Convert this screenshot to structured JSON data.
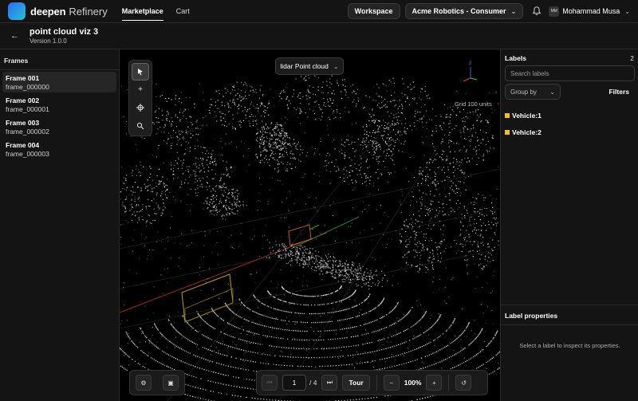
{
  "topbar": {
    "brand": "deepen",
    "brand_sub": "Refinery",
    "nav": [
      "Marketplace",
      "Cart"
    ],
    "workspace_label": "Workspace",
    "org_select": "Acme Robotics - Consumer",
    "user_initials": "MM",
    "user_name": "Mohammad Musa"
  },
  "titlebar": {
    "title": "point cloud viz 3",
    "version": "Version 1.0.0"
  },
  "frames_panel": {
    "heading": "Frames",
    "frames": [
      {
        "title": "Frame 001",
        "file": "frame_000000"
      },
      {
        "title": "Frame 002",
        "file": "frame_000001"
      },
      {
        "title": "Frame 003",
        "file": "frame_000002"
      },
      {
        "title": "Frame 004",
        "file": "frame_000003"
      }
    ]
  },
  "viewer": {
    "source": "lidar Point cloud",
    "grid_label": "Grid 100 units",
    "axis_z": "Z",
    "page_current": "1",
    "page_total": "/ 4",
    "tour_label": "Tour",
    "zoom": "100%"
  },
  "labels_panel": {
    "heading": "Labels",
    "count": "2",
    "search_placeholder": "Search labels",
    "group_by": "Group by",
    "filters": "Filters",
    "labels": [
      "Vehicle:1",
      "Vehicle:2"
    ],
    "label_color": "#f0c020"
  },
  "properties_panel": {
    "heading": "Label properties",
    "empty_text": "Select a label to inspect its properties."
  }
}
